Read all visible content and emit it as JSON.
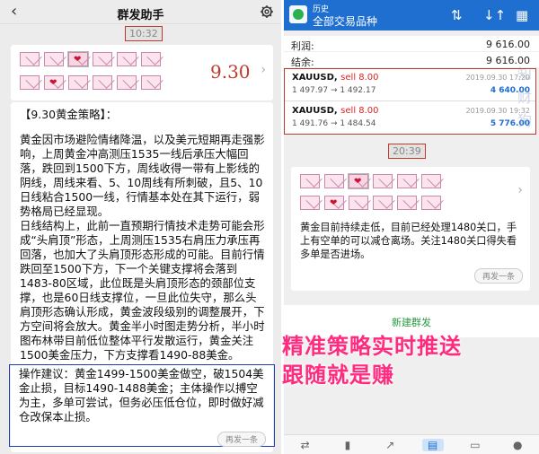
{
  "left": {
    "title": "群发助手",
    "back": "‹",
    "time1": "10:32",
    "date_badge": "9.30",
    "heading": "【9.30黄金策略】：",
    "paragraph1": "黄金因市场避险情绪降温，以及美元短期再走强影响，上周黄金冲高测压1535一线后承压大幅回落，跌回到1500下方，周线收得一带有上影线的阴线，周线来看、5、10周线有所刺破，且5、10日线粘合1500一线，行情基本处在其下运行，弱势格局已经显现。",
    "paragraph2": "日线结构上，此前一直预期行情技术走势可能会形成“头肩顶”形态，上周测压1535右肩压力承压再回落，也加大了头肩顶形态形成的可能。目前行情跌回至1500下方，下一个关键支撑将会落到1483-80区域，此位既是头肩顶形态的颈部位支撑，也是60日线支撑位，一旦此位失守，那么头肩顶形态确认形成，黄金波段级别的调整展开，下方空间将会放大。黄金半小时图走势分析，半小时图布林带目前低位整体平行发散运行，黄金关注1500美金压力，下方支撑看1490-88美金。",
    "advice": "操作建议：黄金1499-1500美金做空，破1504美金止损，目标1490-1488美金；主体操作以搏空为主，多单可尝试，但务必压低仓位，即时做好减仓改保本止损。",
    "resend": "再发一条"
  },
  "right": {
    "header_small": "历史",
    "header_title": "全部交易品种",
    "summary": [
      {
        "k": "利润:",
        "v": "9 616.00"
      },
      {
        "k": "结余:",
        "v": "9 616.00"
      }
    ],
    "orders": [
      {
        "sym": "XAUUSD,",
        "side": "sell 8.00",
        "px": "1 497.97 → 1 492.17",
        "dt": "2019.09.30 17:20",
        "pnl": "4 640.00"
      },
      {
        "sym": "XAUUSD,",
        "side": "sell 8.00",
        "px": "1 491.76 → 1 484.54",
        "dt": "2019.09.30 19:32",
        "pnl": "5 776.00"
      }
    ],
    "time2": "20:39",
    "message": "黄金目前持续走低，目前已经处理1480关口，手上有空单的可以减仓离场。关注1480关口得失看多单是否进场。",
    "resend": "再发一条",
    "new_group": "新建群发",
    "watermark": "知 财 狗"
  },
  "promo": {
    "line1": "精准策略实时推送",
    "line2": "跟随就是赚"
  },
  "colors": {
    "accent": "#1e6fd0",
    "highlight": "#c0392b",
    "promo": "#ff2b7e"
  }
}
